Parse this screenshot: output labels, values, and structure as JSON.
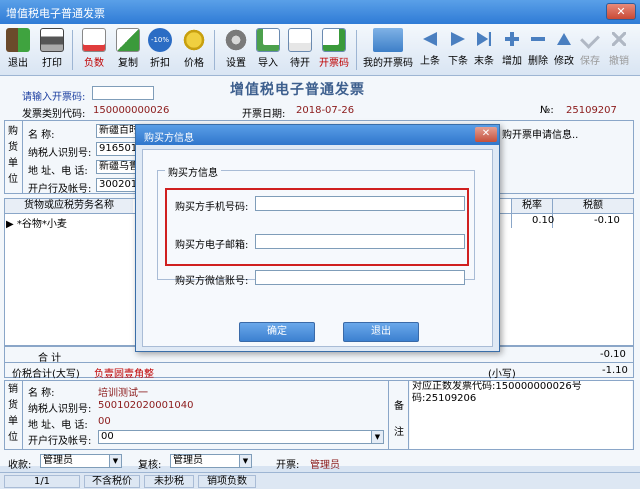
{
  "window": {
    "title": "增值税电子普通发票",
    "close_glyph": "✕"
  },
  "toolbar": {
    "buttons": [
      {
        "label": "退出",
        "icon": "exit-icon"
      },
      {
        "label": "打印",
        "icon": "printer-icon"
      },
      {
        "label": "负数",
        "icon": "negative-icon"
      },
      {
        "label": "复制",
        "icon": "copy-icon"
      },
      {
        "label": "折扣",
        "icon": "discount-icon"
      },
      {
        "label": "价格",
        "icon": "price-icon"
      },
      {
        "label": "设置",
        "icon": "gear-icon"
      },
      {
        "label": "导入",
        "icon": "import-icon"
      },
      {
        "label": "待开",
        "icon": "pending-icon"
      },
      {
        "label": "开票码",
        "icon": "invoice-code-icon"
      },
      {
        "label": "我的开票码",
        "icon": "folder-icon"
      },
      {
        "label": "上条",
        "icon": "prev-icon"
      },
      {
        "label": "下条",
        "icon": "next-icon"
      },
      {
        "label": "末条",
        "icon": "last-icon"
      },
      {
        "label": "增加",
        "icon": "plus-icon"
      },
      {
        "label": "删除",
        "icon": "minus-icon"
      },
      {
        "label": "修改",
        "icon": "edit-icon"
      },
      {
        "label": "保存",
        "icon": "check-icon"
      },
      {
        "label": "撤销",
        "icon": "undo-icon"
      }
    ],
    "discount_badge": "-10%"
  },
  "invoice": {
    "doc_title": "增值税电子普通发票",
    "input_code_label": "请输入开票码:",
    "type_code_label": "发票类别代码:",
    "type_code": "150000000026",
    "date_label": "开票日期:",
    "date": "2018-07-26",
    "no_label": "№:",
    "no": "25109207",
    "buyer": {
      "section_label": [
        "购",
        "货",
        "单",
        "位"
      ],
      "name_label": "名       称:",
      "name": "新疆百时",
      "tax_id_label": "纳税人识别号:",
      "tax_id": "916501C",
      "addr_label": "地 址、电 话:",
      "addr": "新疆乌鲁",
      "bank_label": "开户行及帐号:",
      "bank": "3002010"
    },
    "right_note": "购开票申请信息..",
    "table": {
      "headers": [
        "货物或应税劳务名称",
        "税率",
        "税额"
      ],
      "rows": [
        {
          "marker": "▶",
          "name": "*谷物*小麦",
          "rate": "0.10",
          "tax": "-0.10"
        }
      ]
    },
    "total_label": "合          计",
    "total_value": "-0.10",
    "total_words_label": "价税合计(大写)",
    "total_words": "负壹圆壹角整",
    "small_label": "(小写)",
    "small_value": "-1.10",
    "seller": {
      "section_label": [
        "销",
        "货",
        "单",
        "位"
      ],
      "name_label": "名       称:",
      "name": "培训测试一",
      "tax_id_label": "纳税人识别号:",
      "tax_id": "500102020001040",
      "addr_label": "地 址、电 话:",
      "addr": "00",
      "bank_label": "开户行及帐号:",
      "bank": "00"
    },
    "remark_label": [
      "备",
      "注"
    ],
    "remark": "对应正数发票代码:150000000026号码:25109206",
    "payee_label": "收款:",
    "payee": "管理员",
    "reviewer_label": "复核:",
    "reviewer": "管理员",
    "drawer_label": "开票:",
    "drawer": "管理员"
  },
  "statusbar": [
    "1/1",
    "不含税价",
    "未抄税",
    "销项负数"
  ],
  "dialog": {
    "title": "购买方信息",
    "group_label": "购买方信息",
    "phone_label": "购买方手机号码:",
    "phone_value": "",
    "email_label": "购买方电子邮箱:",
    "email_value": "",
    "wechat_label": "购买方微信账号:",
    "wechat_value": "",
    "ok_label": "确定",
    "exit_label": "退出"
  },
  "colors": {
    "accent": "#2f7bd6",
    "highlight": "#d02020",
    "label_red": "#c00000"
  }
}
